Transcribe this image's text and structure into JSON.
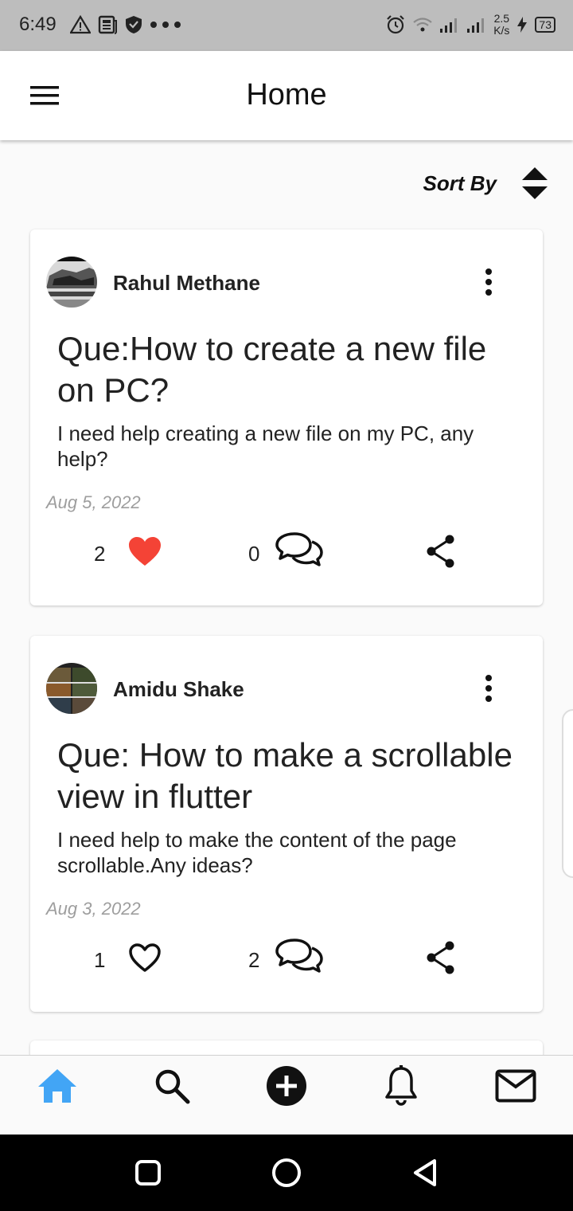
{
  "status_bar": {
    "time": "6:49",
    "net_speed_value": "2.5",
    "net_speed_unit": "K/s",
    "battery": "73"
  },
  "app_bar": {
    "title": "Home"
  },
  "sort": {
    "label": "Sort By"
  },
  "posts": [
    {
      "author": "Rahul Methane",
      "title": "Que:How to create a new file on PC?",
      "body": "I need help creating a new file on my PC, any help?",
      "date": "Aug 5, 2022",
      "likes": "2",
      "liked": true,
      "comments": "0"
    },
    {
      "author": "Amidu Shake",
      "title": "Que: How to make a scrollable view in flutter",
      "body": "I need help to make the content of the page scrollable.Any ideas?",
      "date": "Aug 3, 2022",
      "likes": "1",
      "liked": false,
      "comments": "2"
    }
  ],
  "bottom_nav": {
    "items": [
      "home-icon",
      "search-icon",
      "add-circle-icon",
      "bell-icon",
      "mail-icon"
    ],
    "active": "home-icon"
  },
  "colors": {
    "accent": "#42a5f5",
    "like": "#f44336",
    "status_bar": "#bdbdbd"
  }
}
